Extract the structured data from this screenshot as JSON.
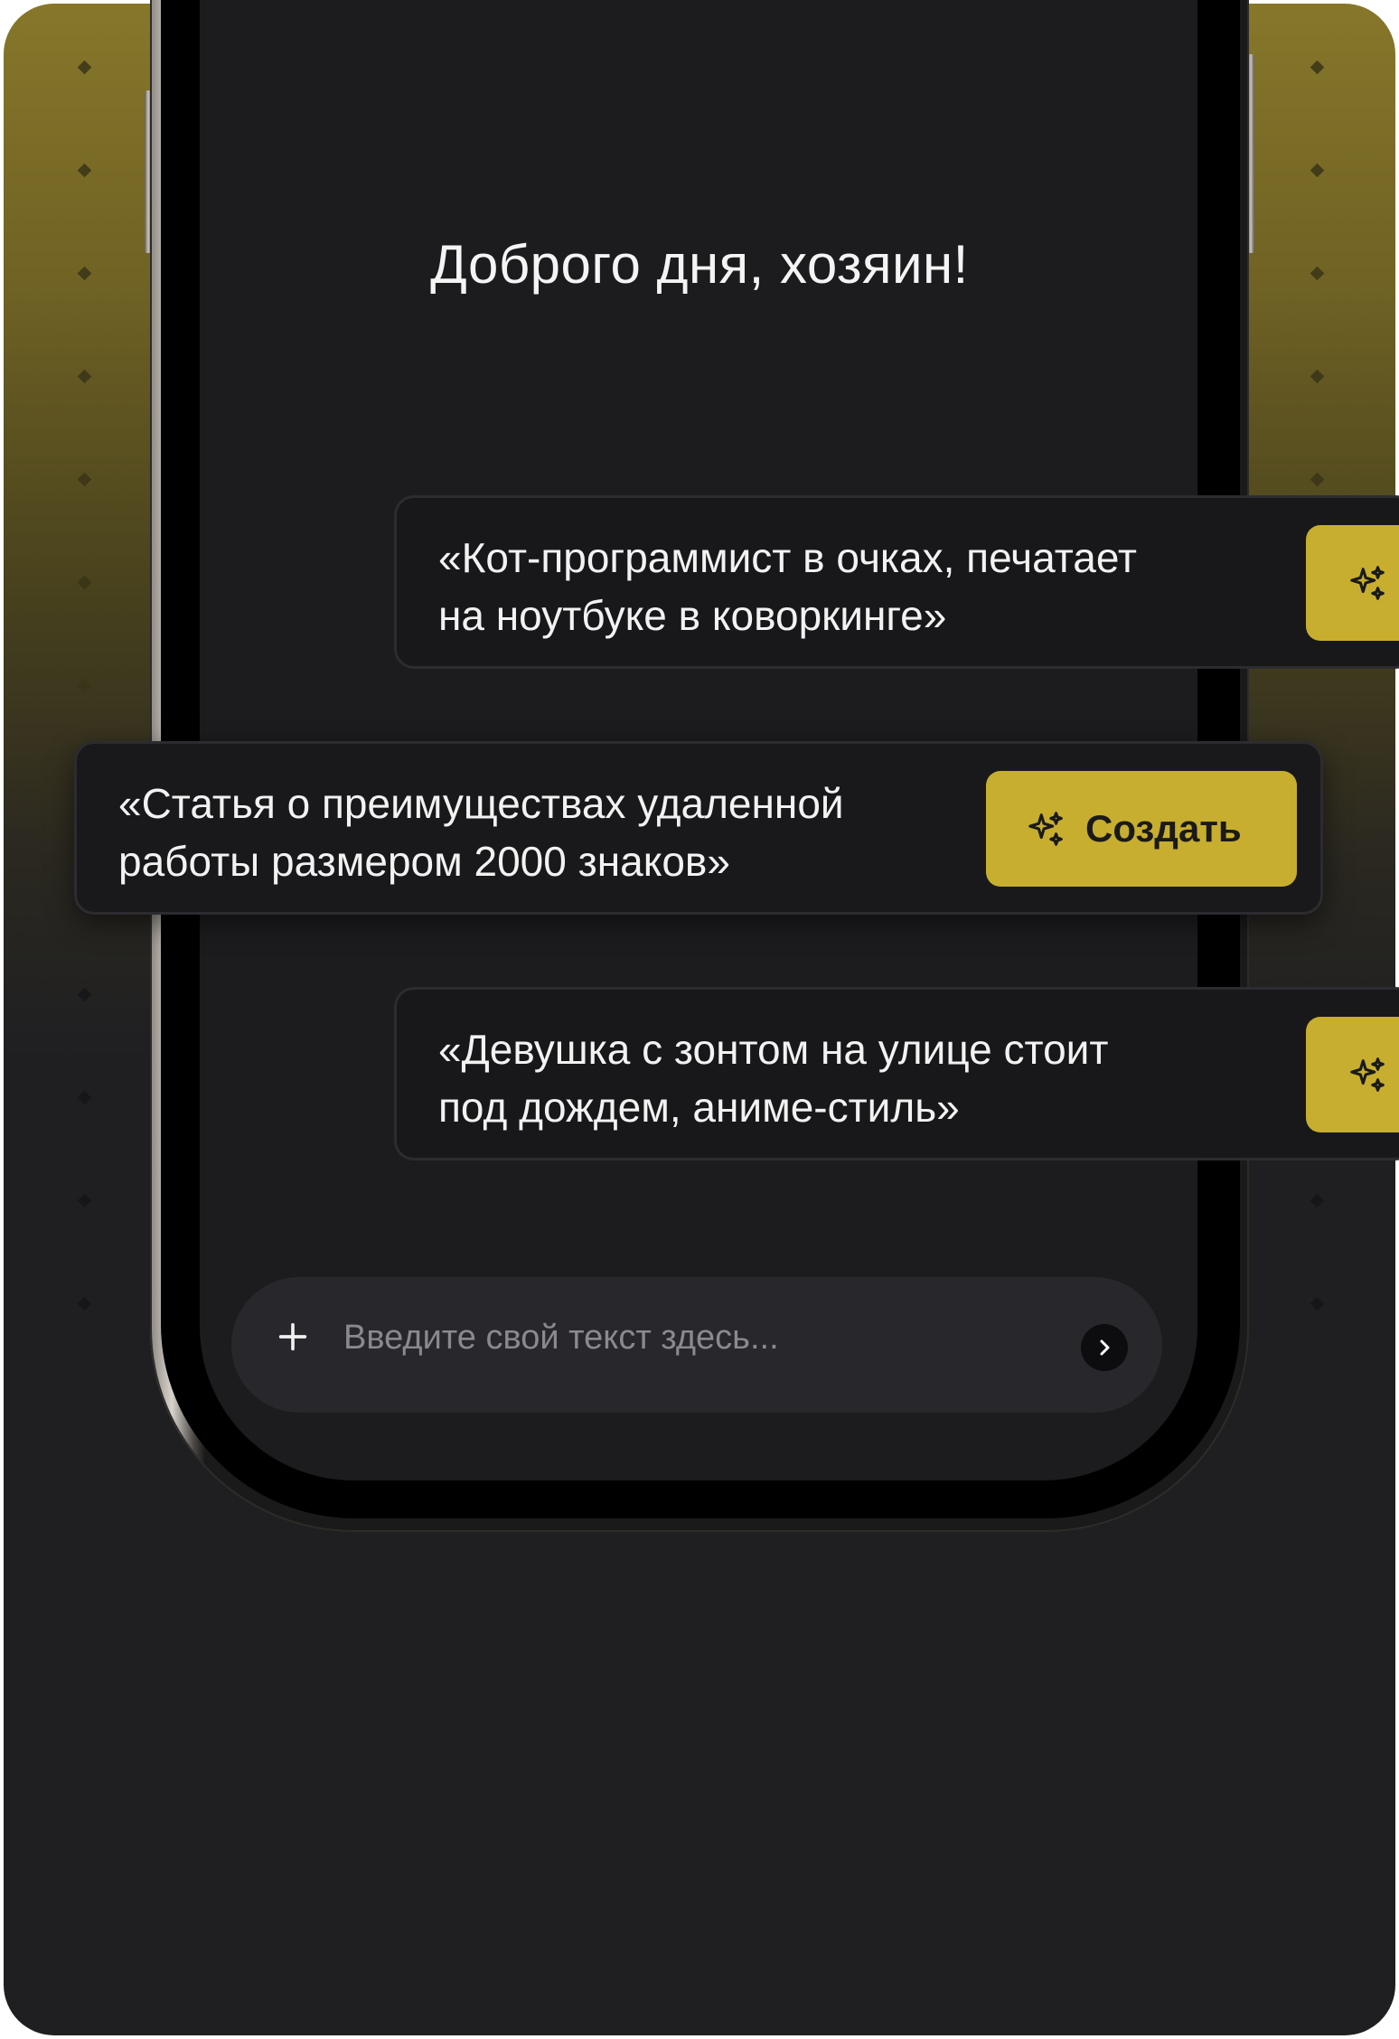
{
  "greeting": "Доброго дня, хозяин!",
  "prompts": [
    {
      "text": "«Кот-программист в очках, печатает\nна ноутбуке в коворкинге»",
      "button_label": ""
    },
    {
      "text": "«Статья о преимуществах удаленной\nработы размером 2000 знаков»",
      "button_label": "Создать"
    },
    {
      "text": "«Девушка с зонтом на улице стоит\nпод дождем, аниме-стиль»",
      "button_label": ""
    }
  ],
  "input": {
    "placeholder": "Введите свой текст здесь..."
  },
  "icons": {
    "add": "plus-icon",
    "send": "chevron-right-icon",
    "generate": "sparkles-icon"
  },
  "colors": {
    "accent": "#c7ae2f",
    "background": "#1f1f22",
    "screen": "#1c1c1f"
  }
}
